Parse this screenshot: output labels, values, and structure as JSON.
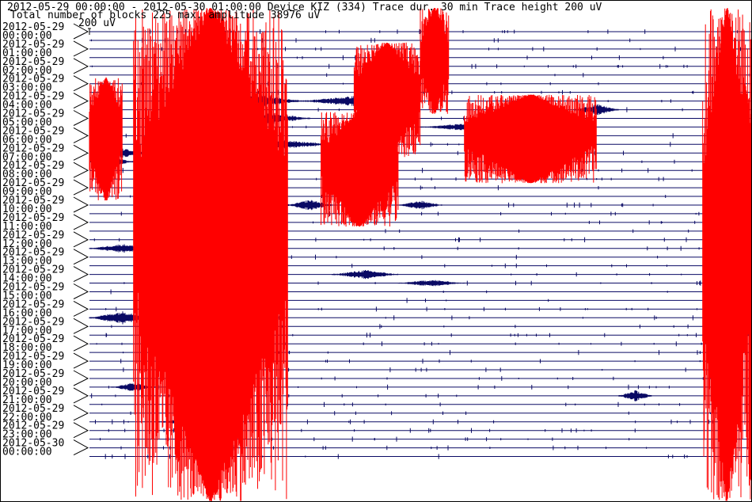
{
  "header": {
    "line1": "2012-05-29 00:00:00 - 2012-05-30 01:00:00  Device  KIZ (334)  Trace dur. 30 min  Trace height 200 uV",
    "line2": "Total number of blocks 225 max. amplitude 38976 uV",
    "scale_label": "200 uV"
  },
  "colors": {
    "trace": "#0a0a64",
    "clipped": "#ff0000",
    "text": "#000000",
    "background": "#ffffff"
  },
  "chart_data": {
    "type": "helicorder",
    "device": "KIZ (334)",
    "start": "2012-05-29 00:00:00",
    "end": "2012-05-30 01:00:00",
    "trace_duration_min": 30,
    "trace_height_uV": 200,
    "total_blocks": 225,
    "max_amplitude_uV": 38976,
    "hour_labels": [
      {
        "date": "2012-05-29",
        "time": "00:00:00"
      },
      {
        "date": "2012-05-29",
        "time": "01:00:00"
      },
      {
        "date": "2012-05-29",
        "time": "02:00:00"
      },
      {
        "date": "2012-05-29",
        "time": "03:00:00"
      },
      {
        "date": "2012-05-29",
        "time": "04:00:00"
      },
      {
        "date": "2012-05-29",
        "time": "05:00:00"
      },
      {
        "date": "2012-05-29",
        "time": "06:00:00"
      },
      {
        "date": "2012-05-29",
        "time": "07:00:00"
      },
      {
        "date": "2012-05-29",
        "time": "08:00:00"
      },
      {
        "date": "2012-05-29",
        "time": "09:00:00"
      },
      {
        "date": "2012-05-29",
        "time": "10:00:00"
      },
      {
        "date": "2012-05-29",
        "time": "11:00:00"
      },
      {
        "date": "2012-05-29",
        "time": "12:00:00"
      },
      {
        "date": "2012-05-29",
        "time": "13:00:00"
      },
      {
        "date": "2012-05-29",
        "time": "14:00:00"
      },
      {
        "date": "2012-05-29",
        "time": "15:00:00"
      },
      {
        "date": "2012-05-29",
        "time": "16:00:00"
      },
      {
        "date": "2012-05-29",
        "time": "17:00:00"
      },
      {
        "date": "2012-05-29",
        "time": "18:00:00"
      },
      {
        "date": "2012-05-29",
        "time": "19:00:00"
      },
      {
        "date": "2012-05-29",
        "time": "20:00:00"
      },
      {
        "date": "2012-05-29",
        "time": "21:00:00"
      },
      {
        "date": "2012-05-29",
        "time": "22:00:00"
      },
      {
        "date": "2012-05-29",
        "time": "23:00:00"
      },
      {
        "date": "2012-05-30",
        "time": "00:00:00"
      }
    ],
    "traces_per_hour": 2,
    "clipped_events": [
      {
        "start_min": 2,
        "end_min": 9,
        "from_trace": 0,
        "to_trace": 49
      },
      {
        "start_min": 0,
        "end_min": 1.5,
        "from_trace": 8,
        "to_trace": 14
      },
      {
        "start_min": 3,
        "end_min": 7,
        "from_trace": 12,
        "to_trace": 20
      },
      {
        "start_min": 10.5,
        "end_min": 14,
        "from_trace": 12,
        "to_trace": 17
      },
      {
        "start_min": 12,
        "end_min": 15,
        "from_trace": 4,
        "to_trace": 9
      },
      {
        "start_min": 15,
        "end_min": 16.3,
        "from_trace": 0,
        "to_trace": 4
      },
      {
        "start_min": 17,
        "end_min": 23,
        "from_trace": 10,
        "to_trace": 12
      },
      {
        "start_min": 27.8,
        "end_min": 30,
        "from_trace": 0,
        "to_trace": 49
      },
      {
        "start_min": 29.5,
        "end_min": 30,
        "from_trace": 9,
        "to_trace": 18
      }
    ],
    "notable_bursts": [
      {
        "trace": 8,
        "start_min": 5.5,
        "end_min": 9.5,
        "strength": 3
      },
      {
        "trace": 8,
        "start_min": 9.5,
        "end_min": 15,
        "strength": 2
      },
      {
        "trace": 9,
        "start_min": 22,
        "end_min": 24,
        "strength": 2
      },
      {
        "trace": 10,
        "start_min": 6.5,
        "end_min": 10,
        "strength": 2
      },
      {
        "trace": 10,
        "start_min": 18,
        "end_min": 21,
        "strength": 2
      },
      {
        "trace": 11,
        "start_min": 15,
        "end_min": 20,
        "strength": 1.5
      },
      {
        "trace": 13,
        "start_min": 3,
        "end_min": 11,
        "strength": 3
      },
      {
        "trace": 14,
        "start_min": 0,
        "end_min": 3,
        "strength": 1.5
      },
      {
        "trace": 14,
        "start_min": 18,
        "end_min": 21,
        "strength": 1.2
      },
      {
        "trace": 15,
        "start_min": 0,
        "end_min": 2,
        "strength": 1.5
      },
      {
        "trace": 20,
        "start_min": 9,
        "end_min": 11,
        "strength": 2
      },
      {
        "trace": 20,
        "start_min": 14,
        "end_min": 16,
        "strength": 1.5
      },
      {
        "trace": 25,
        "start_min": 0,
        "end_min": 3,
        "strength": 1.5
      },
      {
        "trace": 28,
        "start_min": 11,
        "end_min": 14,
        "strength": 1.5
      },
      {
        "trace": 29,
        "start_min": 14,
        "end_min": 17,
        "strength": 1
      },
      {
        "trace": 33,
        "start_min": 0,
        "end_min": 3,
        "strength": 2.5
      },
      {
        "trace": 35,
        "start_min": 29,
        "end_min": 30,
        "strength": 1.5
      },
      {
        "trace": 41,
        "start_min": 1,
        "end_min": 3,
        "strength": 1.5
      },
      {
        "trace": 42,
        "start_min": 24,
        "end_min": 25.5,
        "strength": 2
      },
      {
        "trace": 45,
        "start_min": 3,
        "end_min": 7,
        "strength": 1.2
      }
    ],
    "grid": false
  }
}
